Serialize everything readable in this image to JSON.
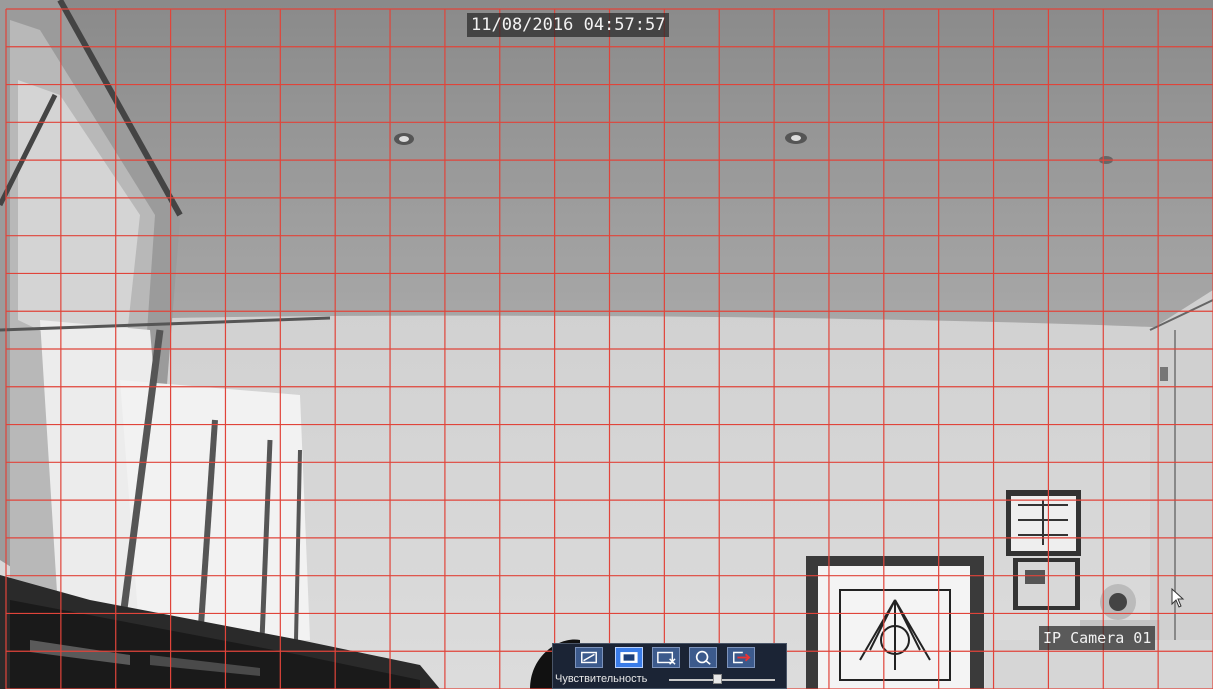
{
  "overlay": {
    "timestamp": "11/08/2016 04:57:57",
    "camera_name": "IP Camera 01"
  },
  "motion_grid": {
    "columns": 22,
    "rows": 18,
    "color": "#e0443a",
    "all_cells_selected": true
  },
  "toolbar": {
    "buttons": [
      {
        "name": "draw-area-button",
        "icon": "draw-area-icon",
        "active": false
      },
      {
        "name": "select-all-button",
        "icon": "full-area-icon",
        "active": true
      },
      {
        "name": "clear-area-button",
        "icon": "clear-area-icon",
        "active": false
      },
      {
        "name": "preview-button",
        "icon": "search-icon",
        "active": false
      },
      {
        "name": "exit-button",
        "icon": "exit-icon",
        "active": false
      }
    ],
    "sensitivity_label": "Чувствительность",
    "sensitivity_level": 0.45
  },
  "colors": {
    "toolbar_bg": "#1b2435",
    "button_bg": "#3c5a8c",
    "button_active": "#3a7ce8"
  }
}
